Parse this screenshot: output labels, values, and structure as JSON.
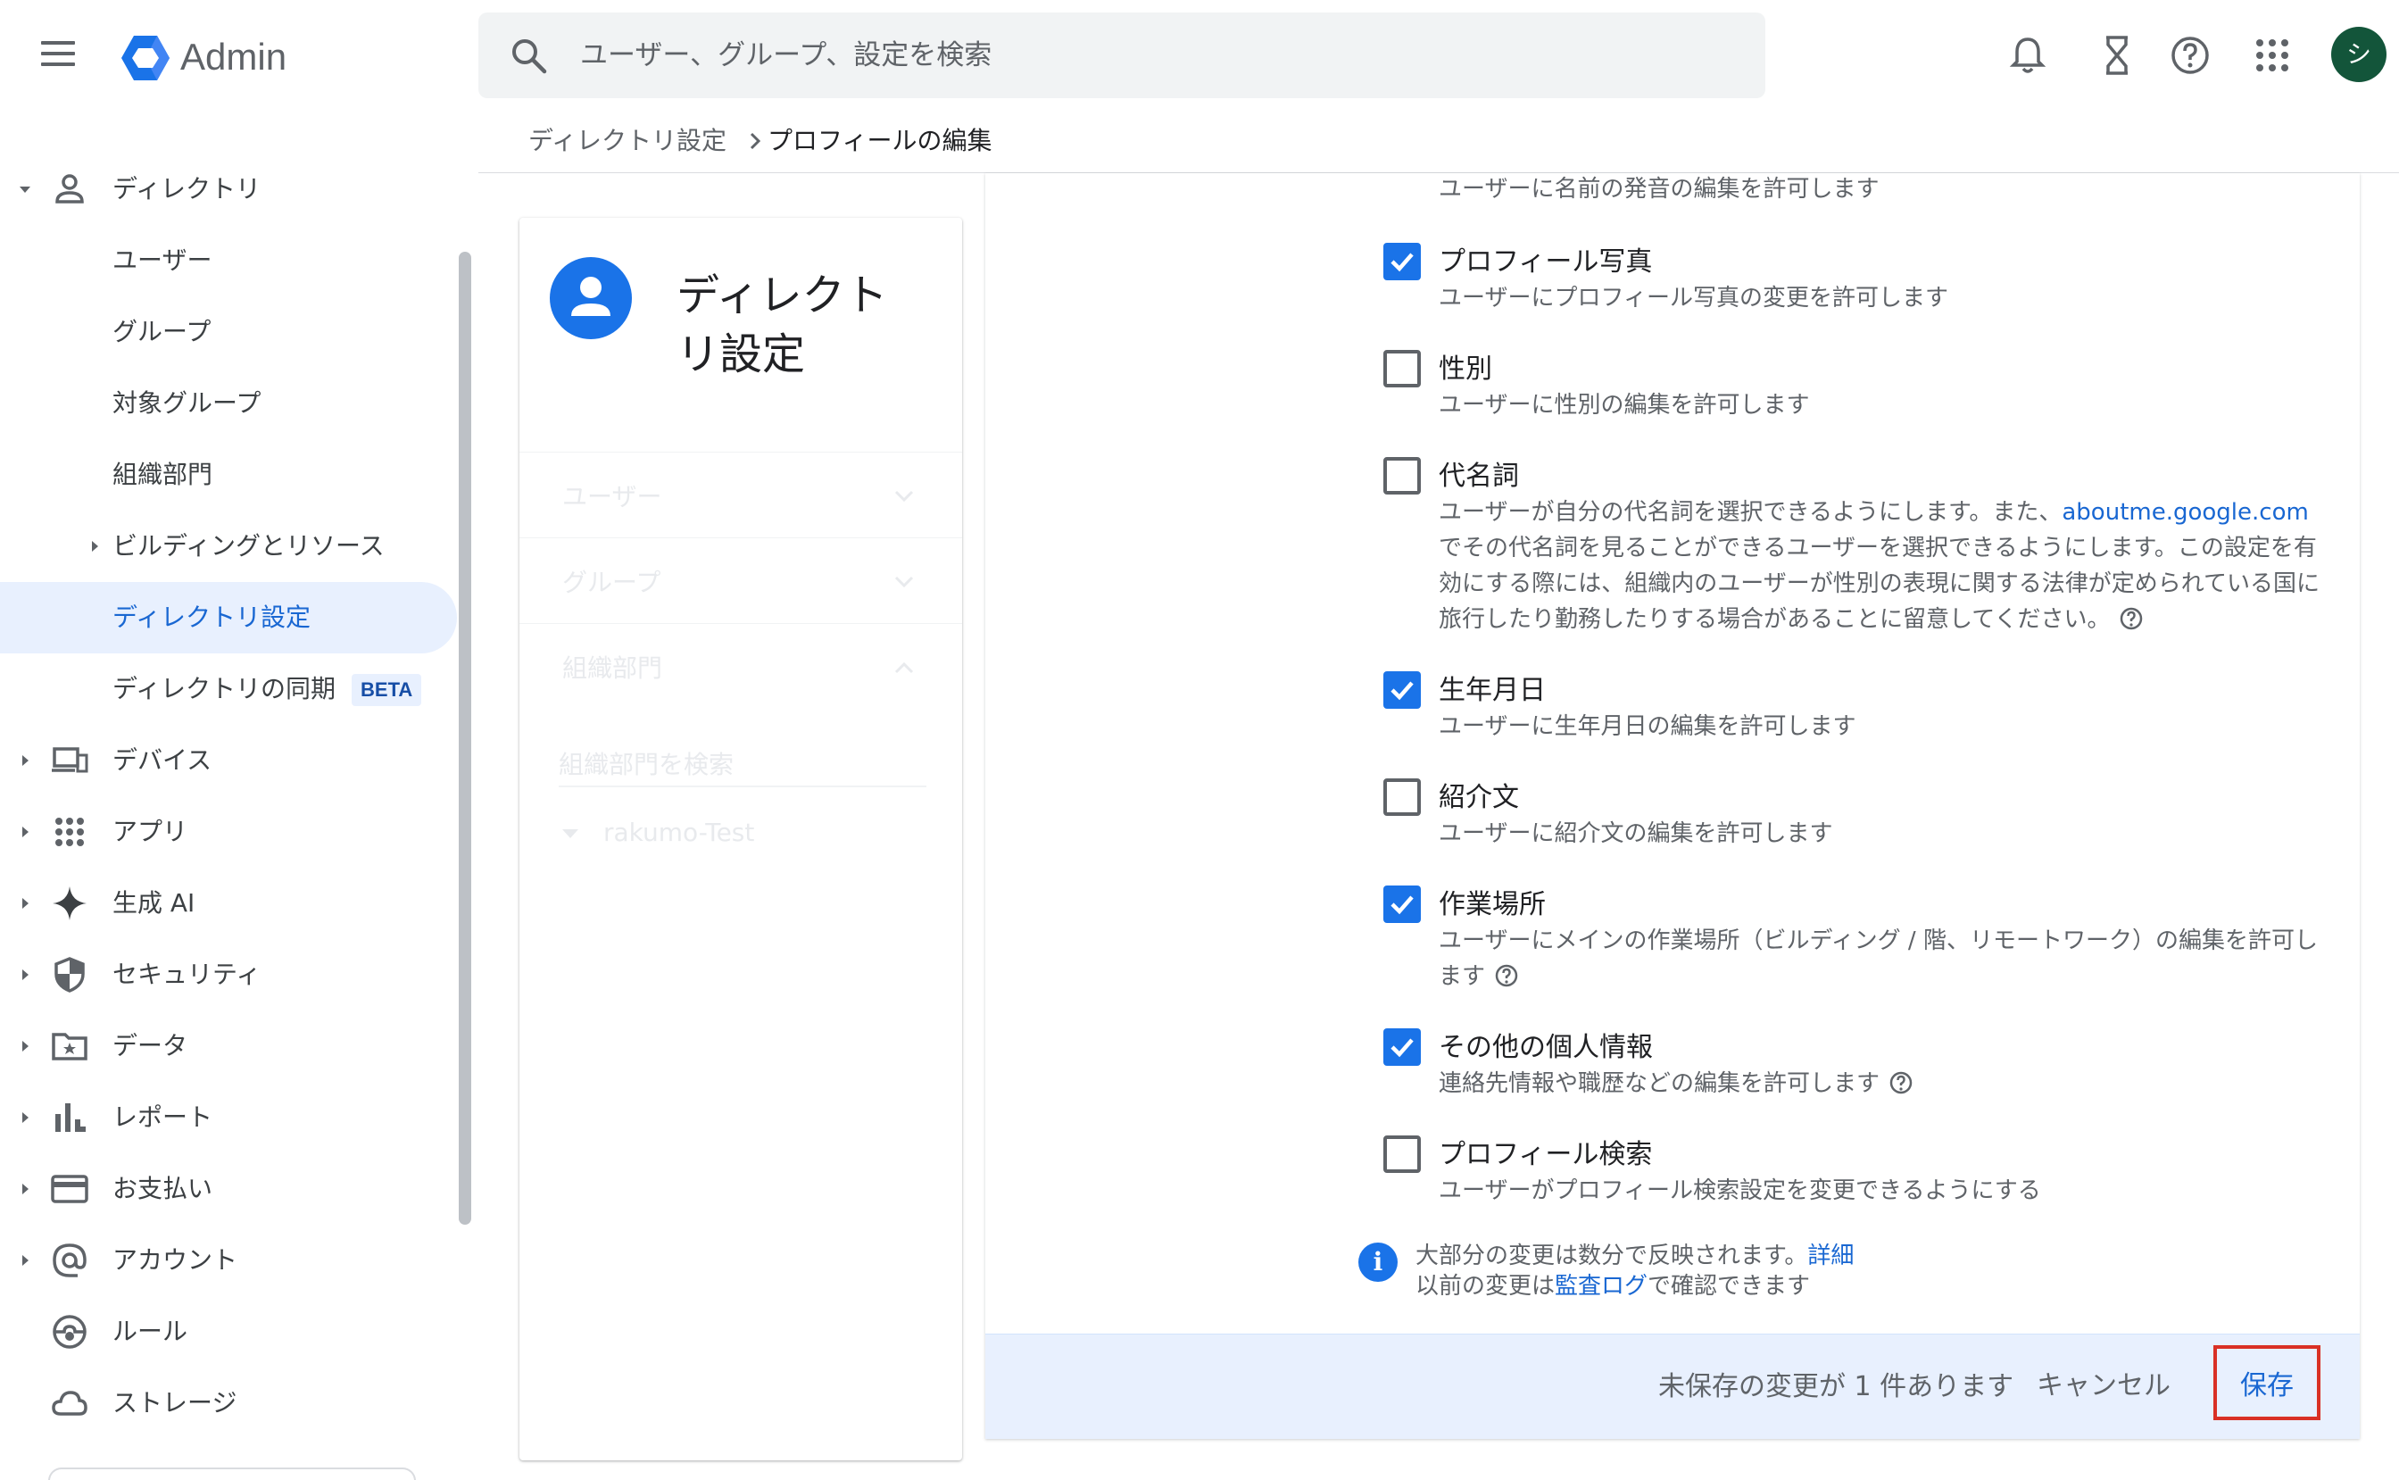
{
  "app": {
    "title": "Admin",
    "menu_icon": "hamburger-menu-icon",
    "logo_icon": "google-admin-logo-icon"
  },
  "search": {
    "placeholder": "ユーザー、グループ、設定を検索"
  },
  "header_icons": [
    "notifications-bell-icon",
    "tasks-hourglass-icon",
    "help-icon",
    "apps-grid-icon"
  ],
  "account": {
    "initial": "シ",
    "color": "#13553a"
  },
  "breadcrumb": {
    "parent": "ディレクトリ設定",
    "current": "プロフィールの編集"
  },
  "sidebar": {
    "items": [
      {
        "label": "ディレクトリ",
        "icon": "person-icon",
        "caret": "expanded"
      },
      {
        "label": "ユーザー"
      },
      {
        "label": "グループ"
      },
      {
        "label": "対象グループ"
      },
      {
        "label": "組織部門"
      },
      {
        "label": "ビルディングとリソース",
        "caret": "collapsed"
      },
      {
        "label": "ディレクトリ設定",
        "active": true
      },
      {
        "label": "ディレクトリの同期",
        "badge": "BETA"
      },
      {
        "label": "デバイス",
        "icon": "devices-icon",
        "caret": "collapsed"
      },
      {
        "label": "アプリ",
        "icon": "apps-grid-icon",
        "caret": "collapsed"
      },
      {
        "label": "生成 AI",
        "icon": "sparkle-icon",
        "caret": "collapsed"
      },
      {
        "label": "セキュリティ",
        "icon": "shield-icon",
        "caret": "collapsed"
      },
      {
        "label": "データ",
        "icon": "folder-star-icon",
        "caret": "collapsed"
      },
      {
        "label": "レポート",
        "icon": "bar-chart-icon",
        "caret": "collapsed"
      },
      {
        "label": "お支払い",
        "icon": "credit-card-icon",
        "caret": "collapsed"
      },
      {
        "label": "アカウント",
        "icon": "at-sign-icon",
        "caret": "collapsed"
      },
      {
        "label": "ルール",
        "icon": "rules-icon"
      },
      {
        "label": "ストレージ",
        "icon": "cloud-icon"
      }
    ]
  },
  "panel": {
    "title": "ディレクトリ設定",
    "sections": [
      {
        "label": "ユーザー",
        "state": "collapsed"
      },
      {
        "label": "グループ",
        "state": "collapsed"
      },
      {
        "label": "組織部門",
        "state": "expanded"
      }
    ],
    "org_search_placeholder": "組織部門を検索",
    "org_root": "rakumo-Test"
  },
  "settings": {
    "top_partial_desc": "ユーザーに名前の発音の編集を許可します",
    "items": [
      {
        "title": "プロフィール写真",
        "desc": "ユーザーにプロフィール写真の変更を許可します",
        "checked": true
      },
      {
        "title": "性別",
        "desc": "ユーザーに性別の編集を許可します",
        "checked": false
      },
      {
        "title": "代名詞",
        "desc_before_link": "ユーザーが自分の代名詞を選択できるようにします。また、",
        "desc_link": "aboutme.google.com",
        "desc_after_link": "でその代名詞を見ることができるユーザーを選択できるようにします。この設定を有効にする際には、組織内のユーザーが性別の表現に関する法律が定められている国に旅行したり勤務したりする場合があることに留意してください。",
        "checked": false,
        "help": true
      },
      {
        "title": "生年月日",
        "desc": "ユーザーに生年月日の編集を許可します",
        "checked": true
      },
      {
        "title": "紹介文",
        "desc": "ユーザーに紹介文の編集を許可します",
        "checked": false
      },
      {
        "title": "作業場所",
        "desc": "ユーザーにメインの作業場所（ビルディング / 階、リモートワーク）の編集を許可します",
        "checked": true,
        "help": true
      },
      {
        "title": "その他の個人情報",
        "desc": "連絡先情報や職歴などの編集を許可します",
        "checked": true,
        "help": true
      },
      {
        "title": "プロフィール検索",
        "desc": "ユーザーがプロフィール検索設定を変更できるようにする",
        "checked": false
      }
    ]
  },
  "info": {
    "line1_text": "大部分の変更は数分で反映されます。",
    "line1_link": "詳細",
    "line2_before": "以前の変更は",
    "line2_link": "監査ログ",
    "line2_after": "で確認できます"
  },
  "footer": {
    "unsaved": "未保存の変更が 1 件あります",
    "cancel": "キャンセル",
    "save": "保存"
  },
  "colors": {
    "accent": "#1a73e8",
    "active_nav_bg": "#e8f0fe",
    "highlight_border": "#d93025"
  }
}
